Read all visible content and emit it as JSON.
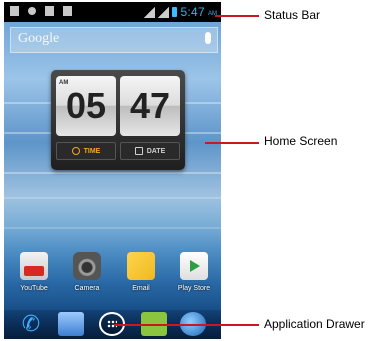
{
  "status_bar": {
    "time": "5:47",
    "ampm": "AM"
  },
  "search": {
    "label": "Google"
  },
  "clock_widget": {
    "hour": "05",
    "minute": "47",
    "period": "AM",
    "tabs": [
      {
        "label": "TIME"
      },
      {
        "label": "DATE"
      }
    ]
  },
  "apps": [
    {
      "label": "YouTube",
      "icon": "youtube-icon"
    },
    {
      "label": "Camera",
      "icon": "camera-icon"
    },
    {
      "label": "Email",
      "icon": "email-icon"
    },
    {
      "label": "Play Store",
      "icon": "play-store-icon"
    }
  ],
  "dock": [
    {
      "icon": "phone-icon"
    },
    {
      "icon": "contacts-icon"
    },
    {
      "icon": "app-drawer-icon"
    },
    {
      "icon": "messaging-icon"
    },
    {
      "icon": "browser-icon"
    }
  ],
  "callouts": {
    "status_bar": "Status Bar",
    "home_screen": "Home Screen",
    "application_drawer": "Application Drawer"
  },
  "colors": {
    "callout_line": "#c8191e",
    "clock_accent": "#f6a623",
    "status_time": "#33b5e5"
  }
}
